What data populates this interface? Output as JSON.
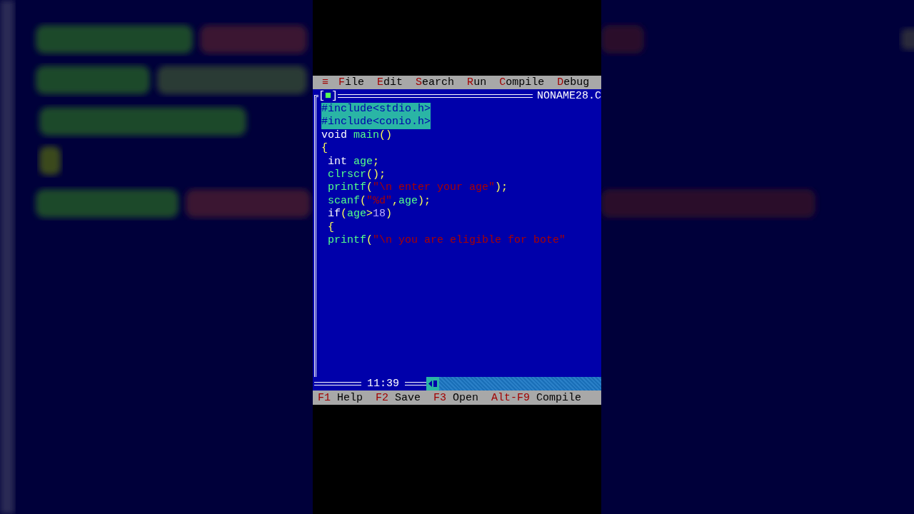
{
  "menu_bar": {
    "system_icon": "≡",
    "items": [
      {
        "label": "File"
      },
      {
        "label": "Edit"
      },
      {
        "label": "Search"
      },
      {
        "label": "Run"
      },
      {
        "label": "Compile"
      },
      {
        "label": "Debug"
      }
    ]
  },
  "editor": {
    "close_box": "[■]",
    "file_name": "NONAME28.C",
    "lines": [
      {
        "selected": true,
        "tokens": [
          {
            "kind": "plain",
            "text": "#include<stdio.h>"
          }
        ]
      },
      {
        "selected": true,
        "tokens": [
          {
            "kind": "plain",
            "text": "#include<conio.h>"
          }
        ]
      },
      {
        "selected": false,
        "tokens": [
          {
            "kind": "keyword",
            "text": "void "
          },
          {
            "kind": "ident",
            "text": "main"
          },
          {
            "kind": "punct",
            "text": "()"
          }
        ]
      },
      {
        "selected": false,
        "tokens": [
          {
            "kind": "punct",
            "text": "{"
          }
        ]
      },
      {
        "selected": false,
        "tokens": [
          {
            "kind": "keyword",
            "text": " int "
          },
          {
            "kind": "ident",
            "text": "age"
          },
          {
            "kind": "punct",
            "text": ";"
          }
        ]
      },
      {
        "selected": false,
        "tokens": [
          {
            "kind": "ident",
            "text": " clrscr"
          },
          {
            "kind": "punct",
            "text": "();"
          }
        ]
      },
      {
        "selected": false,
        "tokens": [
          {
            "kind": "ident",
            "text": " printf"
          },
          {
            "kind": "punct",
            "text": "("
          },
          {
            "kind": "string",
            "text": "\"\\n enter your age\""
          },
          {
            "kind": "punct",
            "text": ");"
          }
        ]
      },
      {
        "selected": false,
        "tokens": [
          {
            "kind": "ident",
            "text": " scanf"
          },
          {
            "kind": "punct",
            "text": "("
          },
          {
            "kind": "string",
            "text": "\"%d\""
          },
          {
            "kind": "punct",
            "text": ","
          },
          {
            "kind": "ident",
            "text": "age"
          },
          {
            "kind": "punct",
            "text": ");"
          }
        ]
      },
      {
        "selected": false,
        "tokens": [
          {
            "kind": "keyword",
            "text": " if"
          },
          {
            "kind": "punct",
            "text": "("
          },
          {
            "kind": "ident",
            "text": "age"
          },
          {
            "kind": "punct",
            "text": ">"
          },
          {
            "kind": "number",
            "text": "18"
          },
          {
            "kind": "punct",
            "text": ")"
          }
        ]
      },
      {
        "selected": false,
        "tokens": [
          {
            "kind": "punct",
            "text": " {"
          }
        ]
      },
      {
        "selected": false,
        "tokens": [
          {
            "kind": "ident",
            "text": " printf"
          },
          {
            "kind": "punct",
            "text": "("
          },
          {
            "kind": "string",
            "text": "\"\\n you are eligible for bote\""
          }
        ]
      }
    ],
    "cursor_position": "11:39"
  },
  "status_bar": [
    {
      "key": "F1",
      "label": "Help"
    },
    {
      "key": "F2",
      "label": "Save"
    },
    {
      "key": "F3",
      "label": "Open"
    },
    {
      "key": "Alt-F9",
      "label": "Compile"
    }
  ]
}
